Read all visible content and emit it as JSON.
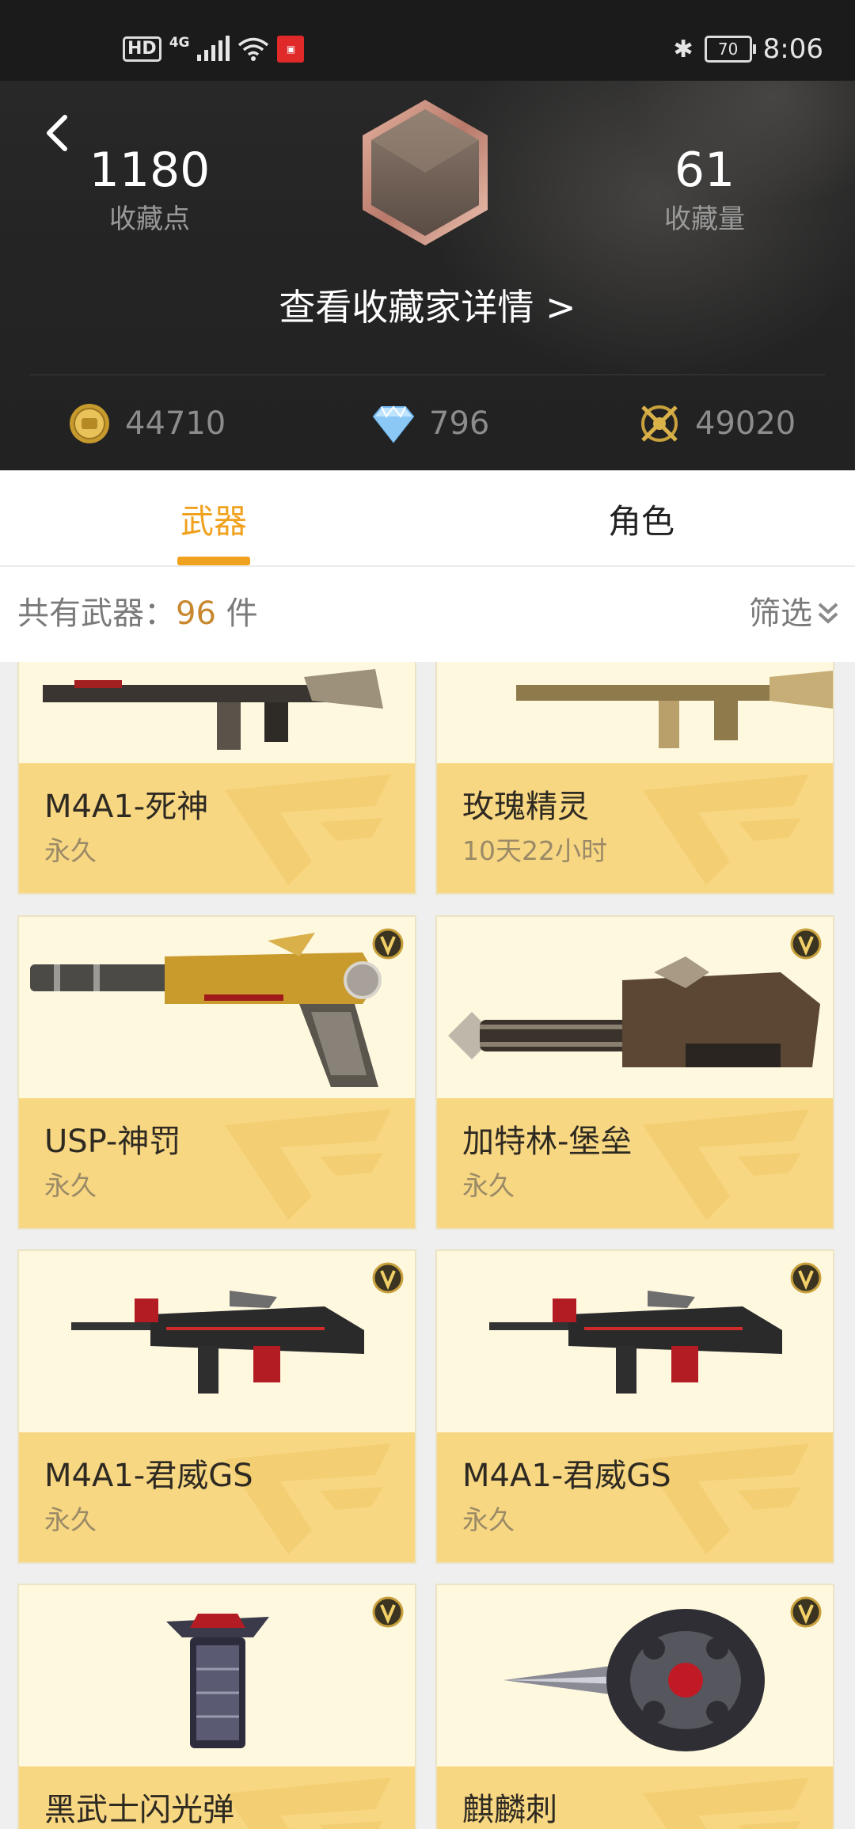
{
  "status_bar": {
    "left_indicators": [
      "HD",
      "4G"
    ],
    "battery": "70",
    "time": "8:06"
  },
  "header": {
    "collection_points": {
      "value": "1180",
      "label": "收藏点"
    },
    "collection_count": {
      "value": "61",
      "label": "收藏量"
    },
    "details_link": "查看收藏家详情 >",
    "currencies": [
      {
        "icon": "gold-coin-icon",
        "value": "44710"
      },
      {
        "icon": "diamond-icon",
        "value": "796"
      },
      {
        "icon": "crossed-swords-icon",
        "value": "49020"
      }
    ]
  },
  "tabs": [
    {
      "label": "武器",
      "active": true
    },
    {
      "label": "角色",
      "active": false
    }
  ],
  "summary": {
    "prefix": "共有武器：",
    "count": "96",
    "unit": " 件",
    "filter_label": "筛选"
  },
  "items": [
    {
      "name": "M4A1-死神",
      "duration": "永久"
    },
    {
      "name": "玫瑰精灵",
      "duration": "10天22小时"
    },
    {
      "name": "USP-神罚",
      "duration": "永久"
    },
    {
      "name": "加特林-堡垒",
      "duration": "永久"
    },
    {
      "name": "M4A1-君威GS",
      "duration": "永久"
    },
    {
      "name": "M4A1-君威GS",
      "duration": "永久"
    },
    {
      "name": "黑武士闪光弹",
      "duration": ""
    },
    {
      "name": "麒麟刺",
      "duration": ""
    }
  ],
  "colors": {
    "accent": "#f0a21e",
    "card_info_bg": "#f8d783",
    "card_image_bg": "#fef8df",
    "header_bg": "#242424"
  }
}
